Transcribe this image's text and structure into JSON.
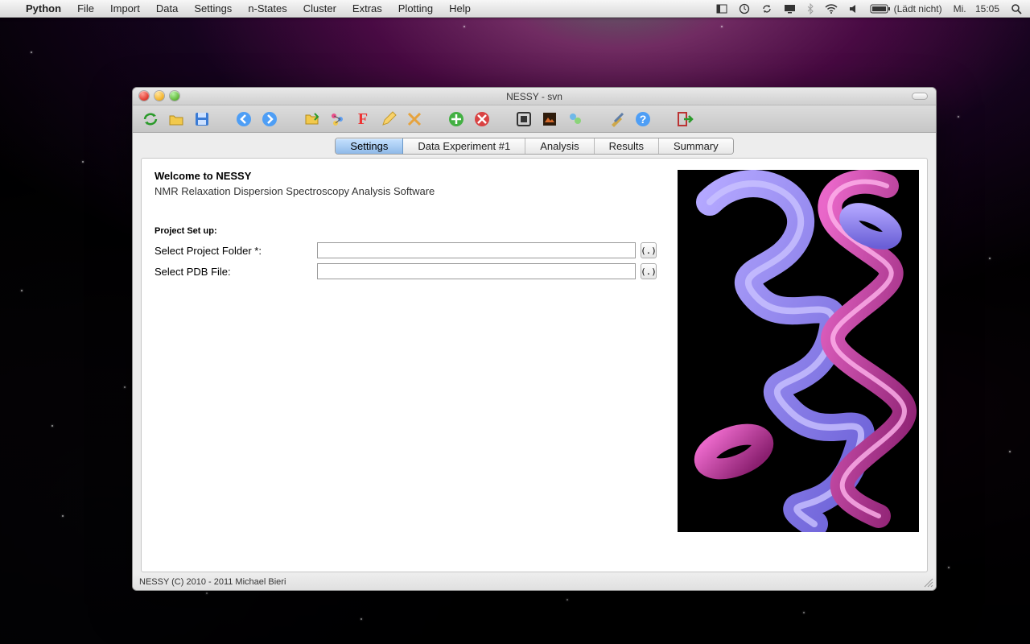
{
  "menubar": {
    "app_name": "Python",
    "items": [
      "File",
      "Import",
      "Data",
      "Settings",
      "n-States",
      "Cluster",
      "Extras",
      "Plotting",
      "Help"
    ],
    "battery_status": "(Lädt nicht)",
    "day": "Mi.",
    "time": "15:05"
  },
  "window": {
    "title": "NESSY - svn"
  },
  "tabs": {
    "items": [
      "Settings",
      "Data Experiment #1",
      "Analysis",
      "Results",
      "Summary"
    ],
    "active_index": 0
  },
  "settings": {
    "welcome": "Welcome to NESSY",
    "subtitle": "NMR Relaxation Dispersion Spectroscopy Analysis Software",
    "section": "Project Set up:",
    "folder_label": "Select Project Folder *:",
    "pdb_label": "Select PDB File:",
    "folder_value": "",
    "pdb_value": "",
    "browse_label": "(.)"
  },
  "statusbar": {
    "text": "NESSY (C) 2010 - 2011 Michael Bieri"
  }
}
